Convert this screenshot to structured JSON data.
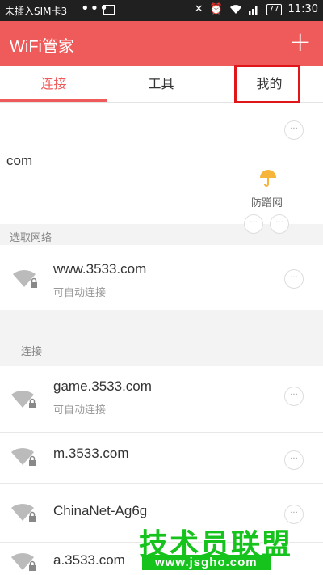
{
  "status_bar": {
    "carrier": "未插入SIM卡3",
    "dots": "•••",
    "battery": "77",
    "time": "11:30"
  },
  "app_bar": {
    "title": "WiFi管家",
    "add_label": "+"
  },
  "tabs": [
    {
      "label": "连接",
      "active": true
    },
    {
      "label": "工具",
      "active": false
    },
    {
      "label": "我的",
      "active": false
    }
  ],
  "connected_card": {
    "partial_name": "com",
    "antiscam_label": "防蹭网",
    "more_label": "···"
  },
  "sections": {
    "select_network": "选取网络",
    "connect": "连接"
  },
  "networks_top": [
    {
      "name": "www.3533.com",
      "subtitle": "可自动连接"
    }
  ],
  "networks_bottom": [
    {
      "name": "game.3533.com",
      "subtitle": "可自动连接"
    },
    {
      "name": "m.3533.com",
      "subtitle": ""
    },
    {
      "name": "ChinaNet-Ag6g",
      "subtitle": ""
    },
    {
      "name": "a.3533.com",
      "subtitle": ""
    }
  ],
  "watermark": {
    "title": "技术员联盟",
    "url": "www.jsgho.com"
  },
  "colors": {
    "brand_red": "#ef5b5b",
    "highlight_red": "#e0161b",
    "watermark_green": "#16c31d"
  }
}
